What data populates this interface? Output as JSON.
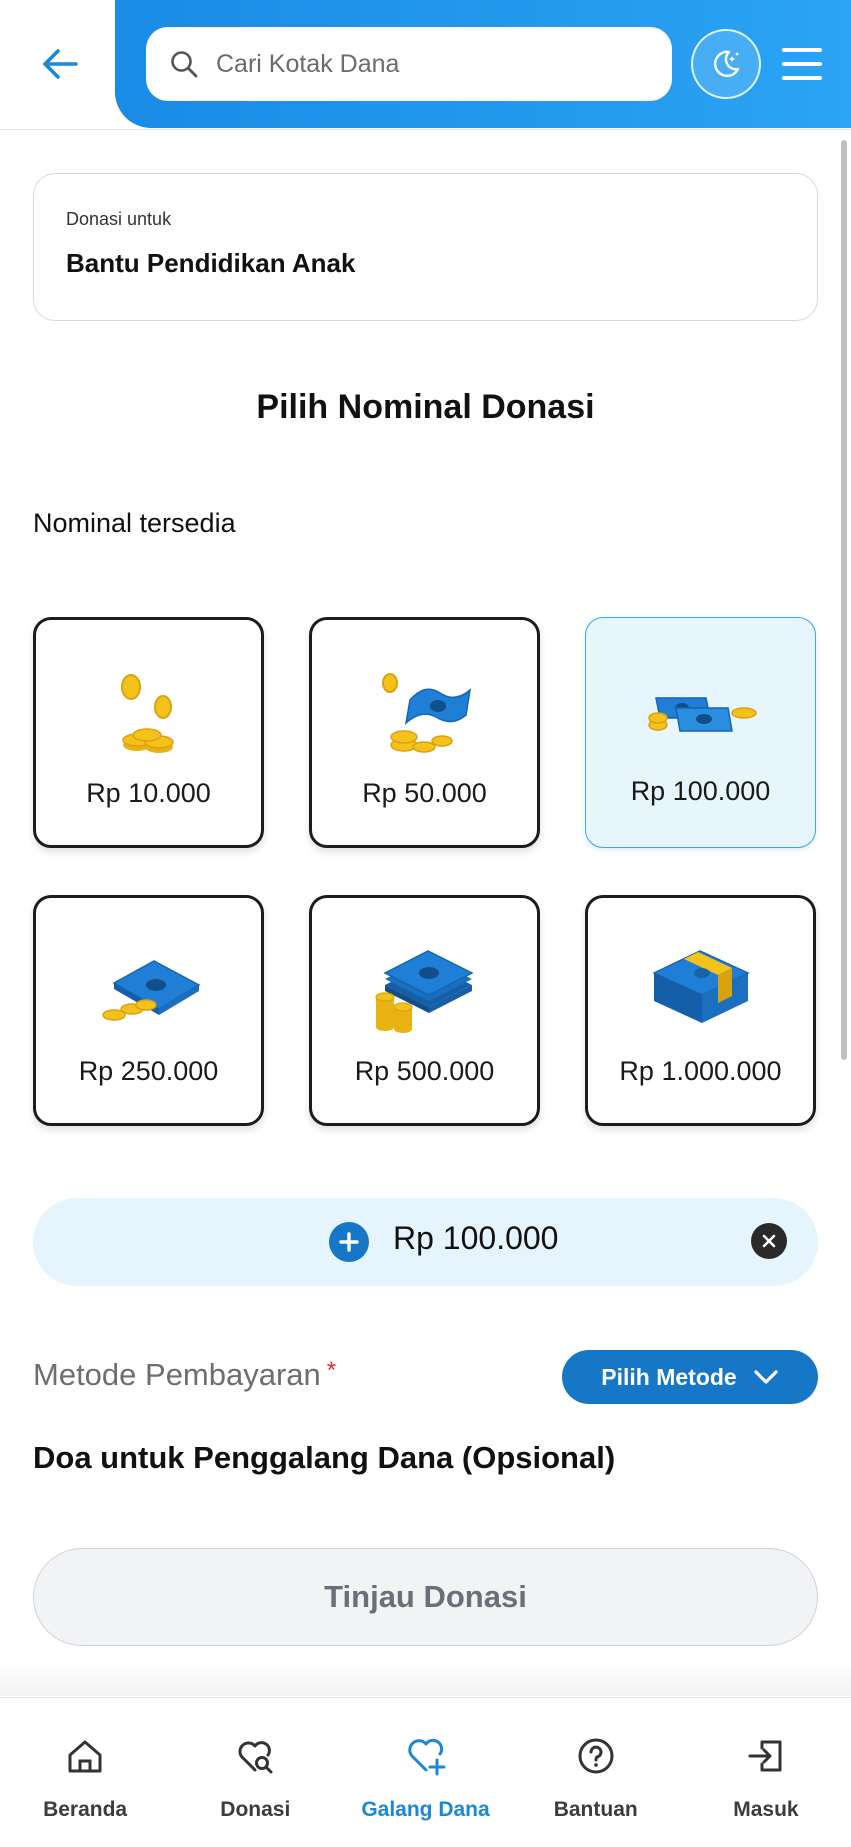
{
  "header": {
    "search_placeholder": "Cari Kotak Dana",
    "back_icon": "arrow-left-icon",
    "theme_icon": "moon-stars-icon",
    "menu_icon": "hamburger-icon"
  },
  "target": {
    "label": "Donasi untuk",
    "name": "Bantu Pendidikan Anak"
  },
  "section_title": "Pilih Nominal Donasi",
  "nominal_label": "Nominal tersedia",
  "nominals": [
    {
      "amount": "Rp 10.000",
      "icon": "coins-icon",
      "selected": false
    },
    {
      "amount": "Rp 50.000",
      "icon": "coins-banknote-icon",
      "selected": false
    },
    {
      "amount": "Rp 100.000",
      "icon": "banknotes-coins-icon",
      "selected": true
    },
    {
      "amount": "Rp 250.000",
      "icon": "banknote-coins-icon",
      "selected": false
    },
    {
      "amount": "Rp 500.000",
      "icon": "banknote-stack-icon",
      "selected": false
    },
    {
      "amount": "Rp 1.000.000",
      "icon": "banknote-bundle-icon",
      "selected": false
    }
  ],
  "amount_input": {
    "value": "Rp 100.000",
    "plus_icon": "plus-icon",
    "clear_icon": "close-icon"
  },
  "payment": {
    "label": "Metode Pembayaran",
    "required_mark": "*",
    "button_label": "Pilih Metode"
  },
  "doa_title": "Doa untuk Penggalang Dana (Opsional)",
  "review_button": "Tinjau Donasi",
  "bottom_nav": [
    {
      "label": "Beranda",
      "icon": "home-icon",
      "active": false
    },
    {
      "label": "Donasi",
      "icon": "heart-search-icon",
      "active": false
    },
    {
      "label": "Galang Dana",
      "icon": "heart-plus-icon",
      "active": true
    },
    {
      "label": "Bantuan",
      "icon": "help-circle-icon",
      "active": false
    },
    {
      "label": "Masuk",
      "icon": "login-icon",
      "active": false
    }
  ],
  "colors": {
    "primary": "#1577c6",
    "header_gradient_start": "#1a8be6",
    "header_gradient_end": "#2aa4f4",
    "selected_bg": "#e7f5fd",
    "active_nav": "#1a88d8",
    "coin": "#f4c21b",
    "banknote": "#1f7fd6"
  }
}
